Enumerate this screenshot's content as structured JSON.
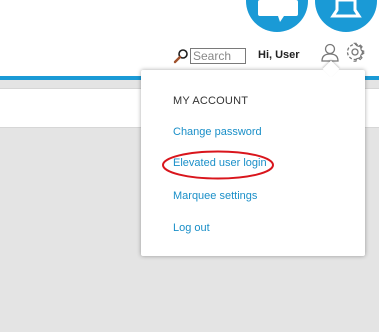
{
  "header": {
    "search": {
      "placeholder": "Search",
      "value": ""
    },
    "greeting": "Hi, User",
    "accent_color": "#1a9ad6",
    "icons": [
      "chat-icon",
      "bell-icon",
      "search-icon",
      "user-icon",
      "gear-icon"
    ]
  },
  "dropdown": {
    "title": "MY ACCOUNT",
    "items": [
      {
        "label": "Change password"
      },
      {
        "label": "Elevated user login"
      },
      {
        "label": "Marquee settings"
      },
      {
        "label": "Log out"
      }
    ],
    "link_color": "#1a8fc8",
    "annotation_color": "#d9151c"
  }
}
